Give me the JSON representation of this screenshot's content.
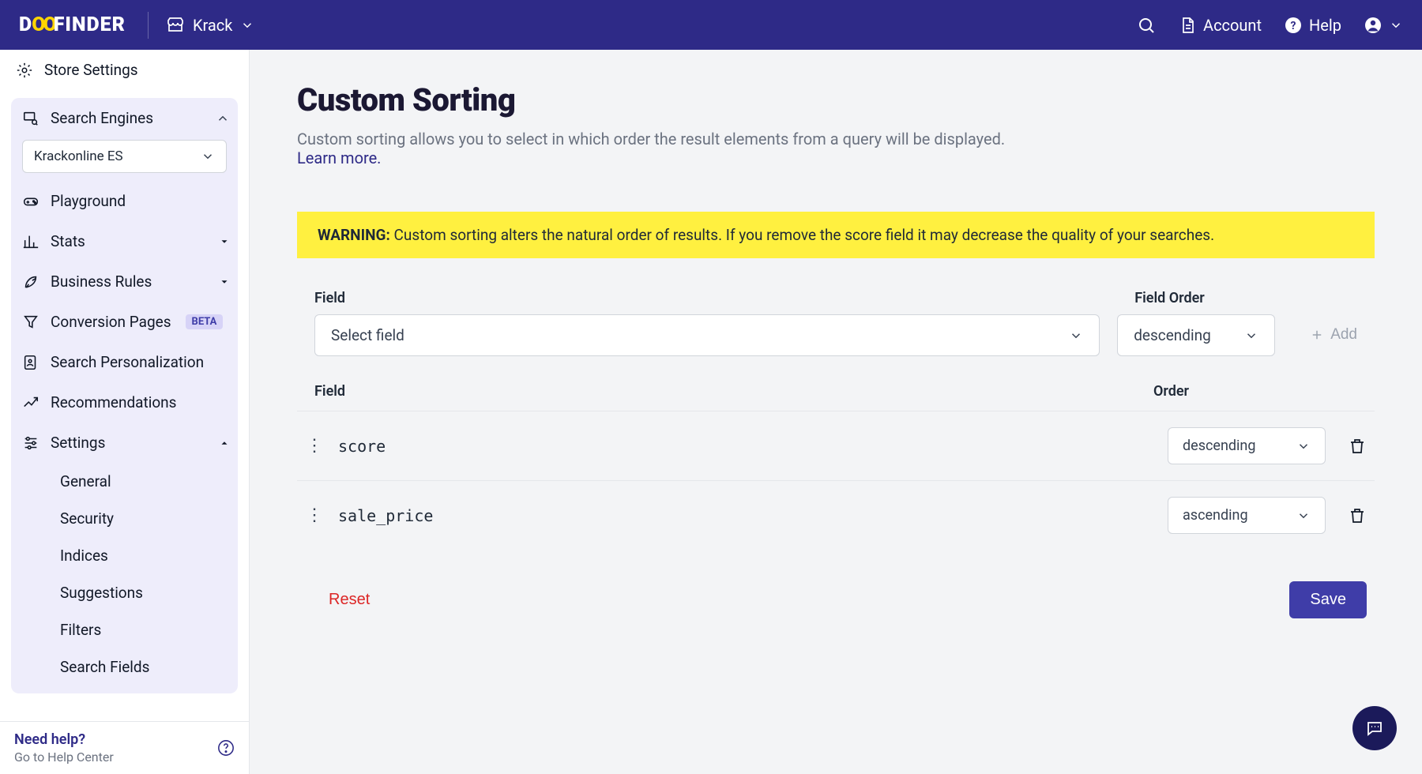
{
  "brand": {
    "part1": "D",
    "part_oo": "OO",
    "part_rest": "FINDER"
  },
  "topbar": {
    "store": "Krack",
    "account": "Account",
    "help": "Help"
  },
  "sidebar": {
    "store_settings": "Store Settings",
    "search_engines": "Search Engines",
    "engine_selected": "Krackonline ES",
    "items": {
      "playground": "Playground",
      "stats": "Stats",
      "business_rules": "Business Rules",
      "conversion": "Conversion Pages",
      "beta_badge": "BETA",
      "personalization": "Search Personalization",
      "recommendations": "Recommendations",
      "settings": "Settings"
    },
    "settings_sub": {
      "general": "General",
      "security": "Security",
      "indices": "Indices",
      "suggestions": "Suggestions",
      "filters": "Filters",
      "search_fields": "Search Fields"
    }
  },
  "help_footer": {
    "title": "Need help?",
    "sub": "Go to Help Center"
  },
  "page": {
    "title": "Custom Sorting",
    "desc": "Custom sorting allows you to select in which order the result elements from a query will be displayed.",
    "learn_more": "Learn more.",
    "warning_label": "WARNING:",
    "warning_text": " Custom sorting alters the natural order of results. If you remove the score field it may decrease the quality of your searches.",
    "form": {
      "field_label": "Field",
      "field_order_label": "Field Order",
      "field_placeholder": "Select field",
      "order_placeholder": "descending",
      "add_btn": "Add"
    },
    "list": {
      "field_header": "Field",
      "order_header": "Order",
      "rows": [
        {
          "field": "score",
          "order": "descending"
        },
        {
          "field": "sale_price",
          "order": "ascending"
        }
      ]
    },
    "actions": {
      "reset": "Reset",
      "save": "Save"
    }
  }
}
